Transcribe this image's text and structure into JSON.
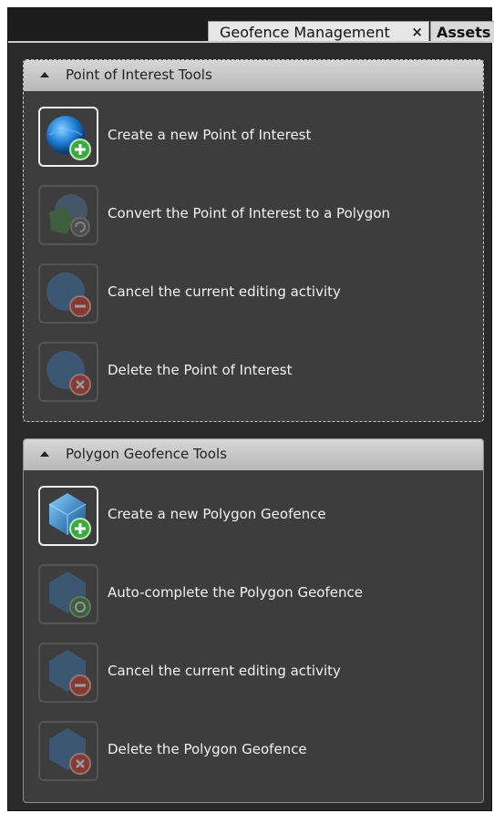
{
  "tabs": [
    {
      "label": "Geofence Management",
      "close": "×"
    },
    {
      "label": "Assets"
    }
  ],
  "groups": [
    {
      "title": "Point of Interest Tools",
      "tools": [
        {
          "label": "Create a new Point of Interest",
          "icon": "globe-add-icon"
        },
        {
          "label": "Convert the Point of Interest to a Polygon",
          "icon": "globe-convert-icon"
        },
        {
          "label": "Cancel the current editing activity",
          "icon": "globe-cancel-icon"
        },
        {
          "label": "Delete the Point of Interest",
          "icon": "globe-delete-icon"
        }
      ]
    },
    {
      "title": "Polygon Geofence Tools",
      "tools": [
        {
          "label": "Create a new Polygon Geofence",
          "icon": "polygon-add-icon"
        },
        {
          "label": "Auto-complete the Polygon Geofence",
          "icon": "polygon-autocomplete-icon"
        },
        {
          "label": "Cancel the current editing activity",
          "icon": "polygon-cancel-icon"
        },
        {
          "label": "Delete the Polygon Geofence",
          "icon": "polygon-delete-icon"
        }
      ]
    }
  ],
  "colors": {
    "background": "#2a2a2a",
    "panel": "#3d3d3d",
    "header": "#c8c8c8",
    "accent_green": "#3caa3c",
    "accent_red": "#c0392b"
  }
}
